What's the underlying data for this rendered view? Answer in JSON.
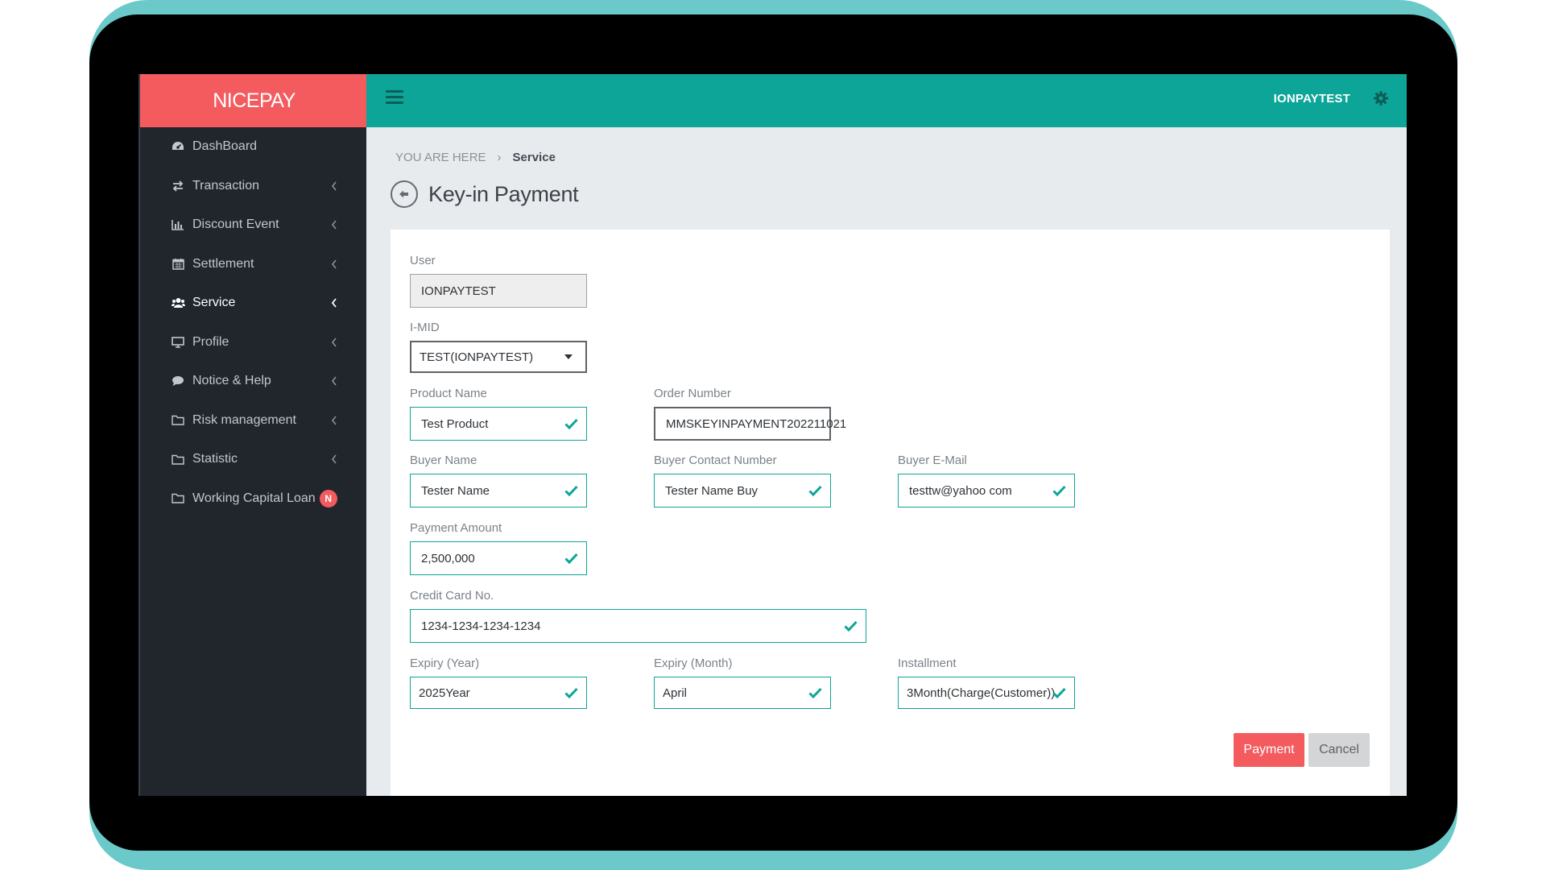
{
  "brand": "NICEPAY",
  "topbar": {
    "username": "IONPAYTEST"
  },
  "sidebar": {
    "items": [
      {
        "label": "DashBoard",
        "icon": "dashboard-icon",
        "chevron": false
      },
      {
        "label": "Transaction",
        "icon": "exchange-icon",
        "chevron": true
      },
      {
        "label": "Discount Event",
        "icon": "bar-chart-icon",
        "chevron": true
      },
      {
        "label": "Settlement",
        "icon": "calendar-icon",
        "chevron": true
      },
      {
        "label": "Service",
        "icon": "users-icon",
        "chevron": true,
        "active": true
      },
      {
        "label": "Profile",
        "icon": "monitor-icon",
        "chevron": true
      },
      {
        "label": "Notice & Help",
        "icon": "comment-icon",
        "chevron": true
      },
      {
        "label": "Risk management",
        "icon": "folder-icon",
        "chevron": true
      },
      {
        "label": "Statistic",
        "icon": "folder-icon",
        "chevron": true
      },
      {
        "label": "Working Capital Loan",
        "icon": "folder-icon",
        "badge": "N"
      }
    ]
  },
  "breadcrumb": {
    "prefix": "YOU ARE HERE",
    "separator": "›",
    "current": "Service"
  },
  "page": {
    "title": "Key-in Payment"
  },
  "form": {
    "user": {
      "label": "User",
      "value": "IONPAYTEST"
    },
    "imid": {
      "label": "I-MID",
      "value": "TEST(IONPAYTEST)"
    },
    "product_name": {
      "label": "Product Name",
      "value": "Test Product"
    },
    "order_number": {
      "label": "Order Number",
      "value": "MMSKEYINPAYMENT202211021"
    },
    "buyer_name": {
      "label": "Buyer Name",
      "value": "Tester Name"
    },
    "buyer_contact": {
      "label": "Buyer Contact Number",
      "value": "Tester Name Buy"
    },
    "buyer_email": {
      "label": "Buyer E-Mail",
      "value": "testtw@yahoo com"
    },
    "payment_amount": {
      "label": "Payment Amount",
      "value": "2,500,000"
    },
    "credit_card": {
      "label": "Credit Card No.",
      "value": "1234-1234-1234-1234"
    },
    "expiry_year": {
      "label": "Expiry (Year)",
      "value": "2025Year"
    },
    "expiry_month": {
      "label": "Expiry (Month)",
      "value": "April"
    },
    "installment": {
      "label": "Installment",
      "value": "3Month(Charge(Customer))"
    }
  },
  "buttons": {
    "payment": "Payment",
    "cancel": "Cancel"
  },
  "colors": {
    "brand": "#f35b5f",
    "topbar": "#0ca597",
    "sidebar": "#21252c",
    "valid": "#0ca597"
  }
}
